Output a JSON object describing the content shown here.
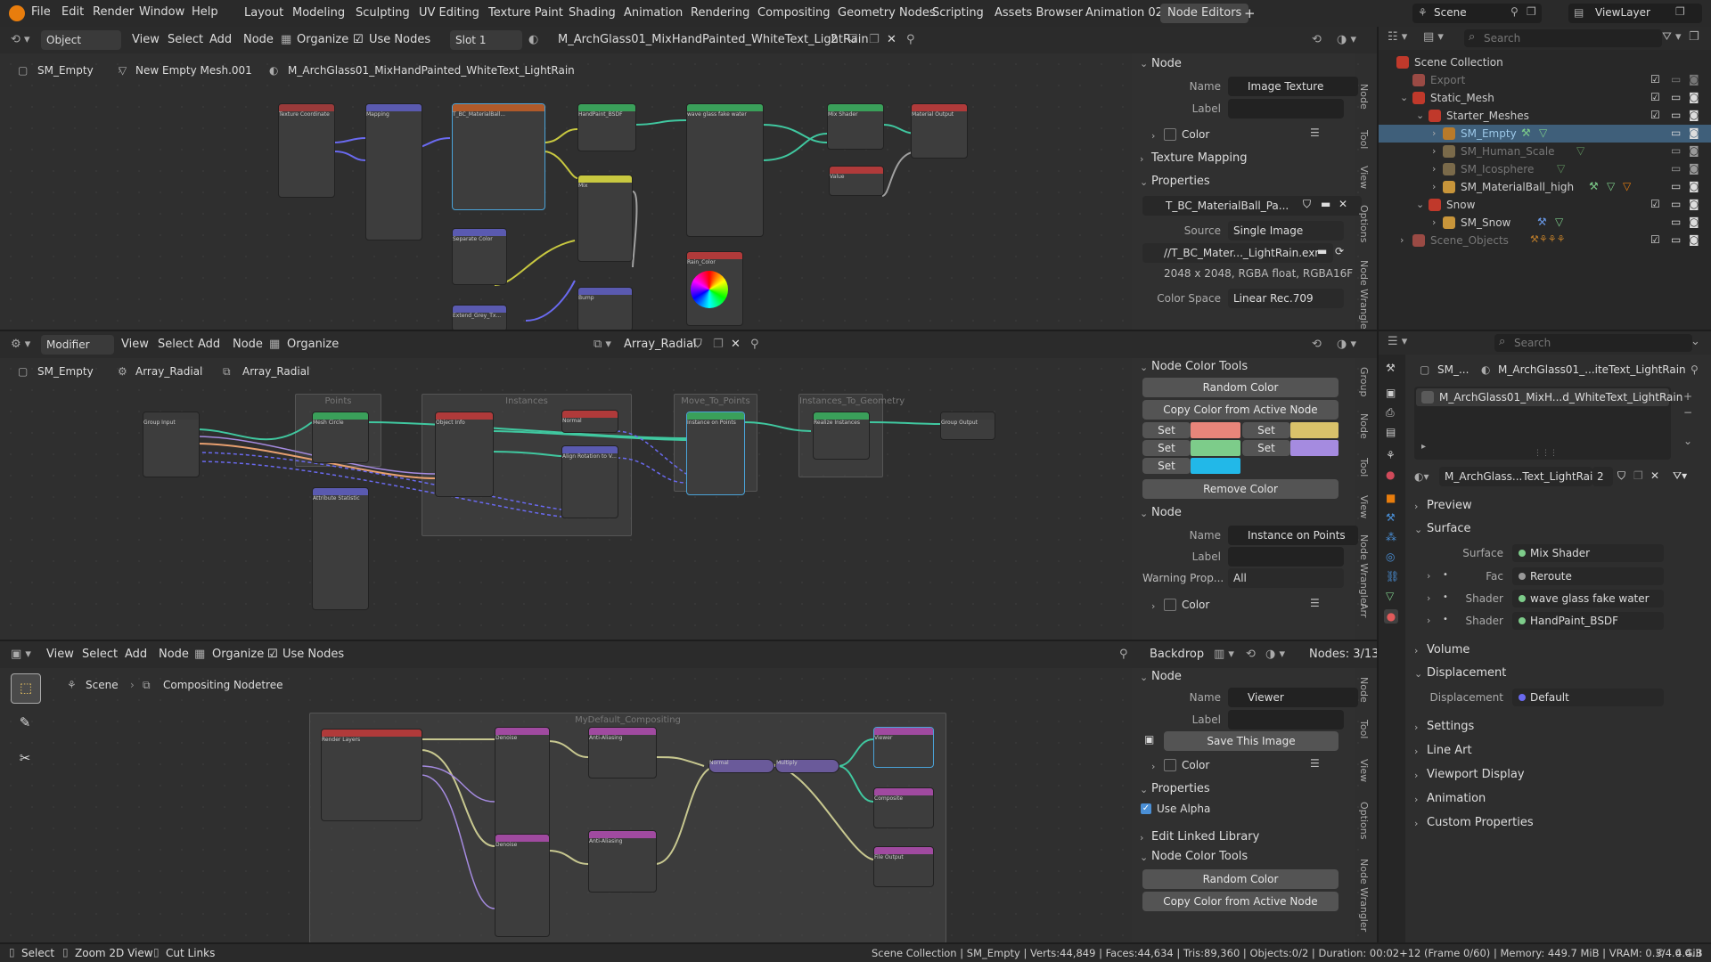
{
  "topbar": {
    "menus": [
      "File",
      "Edit",
      "Render",
      "Window",
      "Help"
    ],
    "workspaces": [
      "Layout",
      "Modeling",
      "Sculpting",
      "UV Editing",
      "Texture Paint",
      "Shading",
      "Animation",
      "Rendering",
      "Compositing",
      "Geometry Nodes",
      "Scripting",
      "Assets Browser",
      "Animation 02",
      "Node Editors"
    ],
    "active_workspace": "Node Editors",
    "add_tab": "+",
    "scene": "Scene",
    "view_layer": "ViewLayer"
  },
  "shader_editor": {
    "header": {
      "mode": "Object",
      "menus": [
        "View",
        "Select",
        "Add",
        "Node"
      ],
      "organize": "Organize",
      "use_nodes": "Use Nodes",
      "slot": "Slot 1",
      "material": "M_ArchGlass01_MixHandPainted_WhiteText_LightRain",
      "users": "2"
    },
    "breadcrumb": [
      "SM_Empty",
      "New Empty Mesh.001",
      "M_ArchGlass01_MixHandPainted_WhiteText_LightRain"
    ],
    "nodes": [
      "Texture Coordinate",
      "Mapping",
      "T_BC_MaterialBall...",
      "HandPaint_BSDF",
      "wave glass fake water",
      "Mix Shader",
      "Material Output",
      "Separate Color",
      "Mix",
      "Value",
      "Rain_Color",
      "Bump",
      "Extend_Grey_Tx..."
    ],
    "sidebar": {
      "node_section": "Node",
      "name_label": "Name",
      "name_value": "Image Texture",
      "label_label": "Label",
      "color_label": "Color",
      "texture_mapping": "Texture Mapping",
      "properties": "Properties",
      "image_name": "T_BC_MaterialBall_Pa...",
      "source_label": "Source",
      "source_value": "Single Image",
      "filepath": "//T_BC_Mater..._LightRain.exr",
      "image_info": "2048 x 2048,  RGBA float,  RGBA16F",
      "colorspace_label": "Color Space",
      "colorspace_value": "Linear Rec.709"
    },
    "vtabs": [
      "Node",
      "Tool",
      "View",
      "Options",
      "Node Wrangler"
    ]
  },
  "geometry_editor": {
    "header": {
      "mode": "Modifier",
      "menus": [
        "View",
        "Select",
        "Add",
        "Node"
      ],
      "organize": "Organize",
      "tree": "Array_Radial"
    },
    "breadcrumb": [
      "SM_Empty",
      "Array_Radial",
      "Array_Radial"
    ],
    "frames": [
      "Points",
      "Instances",
      "Move_To_Points",
      "Instances_To_Geometry"
    ],
    "nodes": [
      "Group Input",
      "Mesh Circle",
      "Attribute Statistic",
      "Object Info",
      "Normal",
      "Align Rotation to V...",
      "Instance on Points",
      "Realize Instances",
      "Group Output"
    ],
    "sidebar": {
      "color_tools": "Node Color Tools",
      "random_color": "Random Color",
      "copy_color": "Copy Color from Active Node",
      "set_label": "Set",
      "remove_color": "Remove Color",
      "node_section": "Node",
      "name_label": "Name",
      "name_value": "Instance on Points",
      "label_label": "Label",
      "warning_label": "Warning Prop...",
      "warning_value": "All",
      "color_label": "Color",
      "swatches": [
        "#e8857a",
        "#d9c26a",
        "#7dcc8a",
        "#a58be0",
        "#22b8e8"
      ]
    },
    "vtabs": [
      "Group",
      "Node",
      "Tool",
      "View",
      "Node Wrangler",
      "Arr"
    ]
  },
  "compositor": {
    "header": {
      "menus": [
        "View",
        "Select",
        "Add",
        "Node"
      ],
      "organize": "Organize",
      "use_nodes": "Use Nodes",
      "backdrop": "Backdrop",
      "nodes_count": "Nodes: 3/13"
    },
    "breadcrumb": [
      "Scene",
      "Compositing Nodetree"
    ],
    "frame": "MyDefault_Compositing",
    "nodes": [
      "Render Layers",
      "Denoise",
      "Anti-Aliasing",
      "Denoise",
      "Anti-Aliasing",
      "Normal",
      "Multiply",
      "Viewer",
      "Composite",
      "File Output"
    ],
    "sidebar": {
      "node_section": "Node",
      "name_label": "Name",
      "name_value": "Viewer",
      "label_label": "Label",
      "save_image": "Save This Image",
      "color_label": "Color",
      "properties": "Properties",
      "use_alpha": "Use Alpha",
      "edit_linked": "Edit Linked Library",
      "color_tools": "Node Color Tools",
      "random_color": "Random Color",
      "copy_color": "Copy Color from Active Node"
    },
    "vtabs": [
      "Node",
      "Tool",
      "View",
      "Options",
      "Node Wrangler"
    ]
  },
  "outliner": {
    "search_placeholder": "Search",
    "rows": [
      {
        "label": "Scene Collection",
        "indent": 0
      },
      {
        "label": "Export",
        "indent": 1
      },
      {
        "label": "Static_Mesh",
        "indent": 1
      },
      {
        "label": "Starter_Meshes",
        "indent": 2
      },
      {
        "label": "SM_Empty",
        "indent": 3
      },
      {
        "label": "SM_Human_Scale",
        "indent": 3
      },
      {
        "label": "SM_Icosphere",
        "indent": 3
      },
      {
        "label": "SM_MaterialBall_high",
        "indent": 3
      },
      {
        "label": "Snow",
        "indent": 2
      },
      {
        "label": "SM_Snow",
        "indent": 3
      },
      {
        "label": "Scene_Objects",
        "indent": 1
      }
    ]
  },
  "properties": {
    "search_placeholder": "Search",
    "breadcrumb": [
      "SM_...",
      "M_ArchGlass01_MixHandPainted_WhiteText_LightRain"
    ],
    "breadcrumb_display": "M_ArchGlass01_...iteText_LightRain",
    "material_slot": "M_ArchGlass01_MixH...d_WhiteText_LightRain",
    "material_name": "M_ArchGlass...Text_LightRain",
    "users": "2",
    "sections": {
      "preview": "Preview",
      "surface": "Surface",
      "surface_label": "Surface",
      "surface_value": "Mix Shader",
      "fac_label": "Fac",
      "fac_value": "Reroute",
      "shader1_label": "Shader",
      "shader1_value": "wave glass fake water",
      "shader2_label": "Shader",
      "shader2_value": "HandPaint_BSDF",
      "volume": "Volume",
      "displacement": "Displacement",
      "displacement_label": "Displacement",
      "displacement_value": "Default",
      "settings": "Settings",
      "line_art": "Line Art",
      "viewport_display": "Viewport Display",
      "animation": "Animation",
      "custom_properties": "Custom Properties"
    }
  },
  "statusbar": {
    "select": "Select",
    "zoom": "Zoom 2D View",
    "cut": "Cut Links",
    "stats": "Scene Collection | SM_Empty | Verts:44,849 | Faces:44,634 | Tris:89,360 | Objects:0/2 | Duration: 00:02+12 (Frame 0/60) | Memory: 449.7 MiB | VRAM: 0.3/4.0 GiB",
    "version": "4.4.3"
  }
}
